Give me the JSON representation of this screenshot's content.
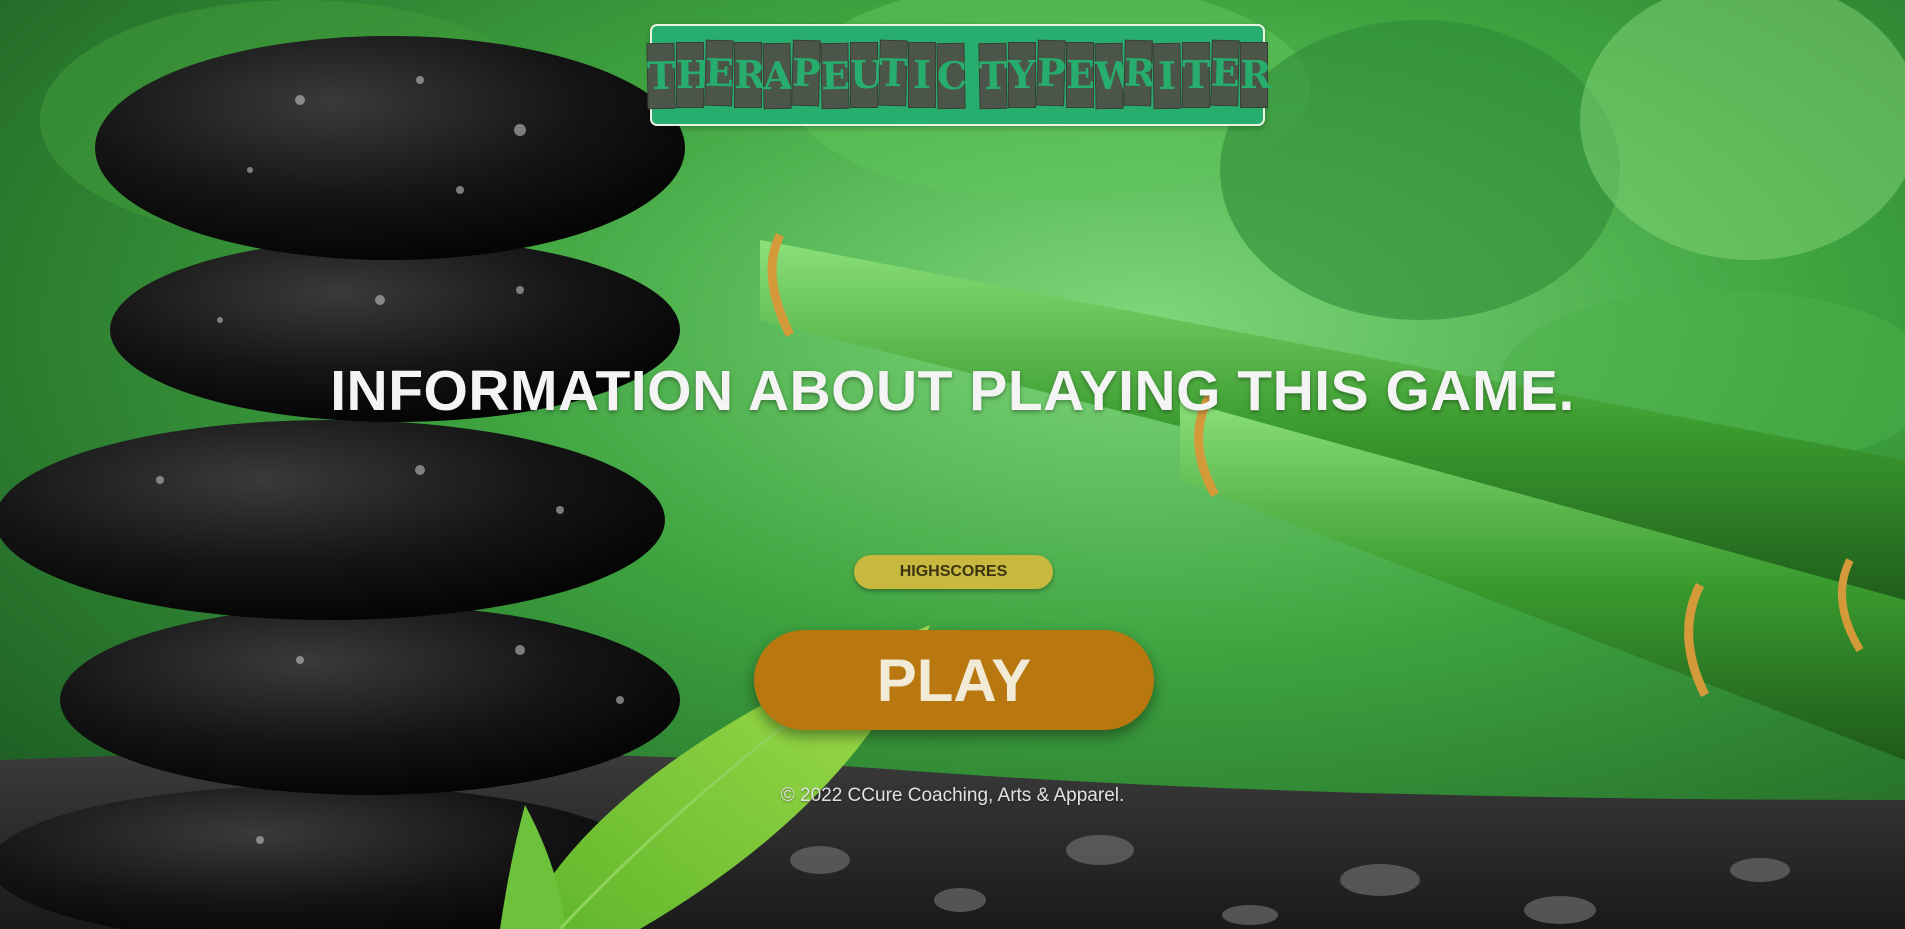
{
  "logo": {
    "words": [
      [
        "T",
        "H",
        "E",
        "R",
        "A",
        "P",
        "E",
        "U",
        "T",
        "I",
        "C"
      ],
      [
        "T",
        "Y",
        "P",
        "E",
        "W",
        "R",
        "I",
        "T",
        "E",
        "R"
      ]
    ],
    "text": "THERAPEUTIC TYPEWRITER"
  },
  "info_text": "INFORMATION ABOUT PLAYING THIS GAME.",
  "buttons": {
    "highscores": "HIGHSCORES",
    "play": "PLAY"
  },
  "footer": "© 2022 CCure Coaching, Arts & Apparel.",
  "colors": {
    "logo_bg": "#27ad6d",
    "logo_tile": "#4b5548",
    "highscores_bg": "#c8b840",
    "play_bg": "#b8780f",
    "text": "#f4f4f4"
  }
}
